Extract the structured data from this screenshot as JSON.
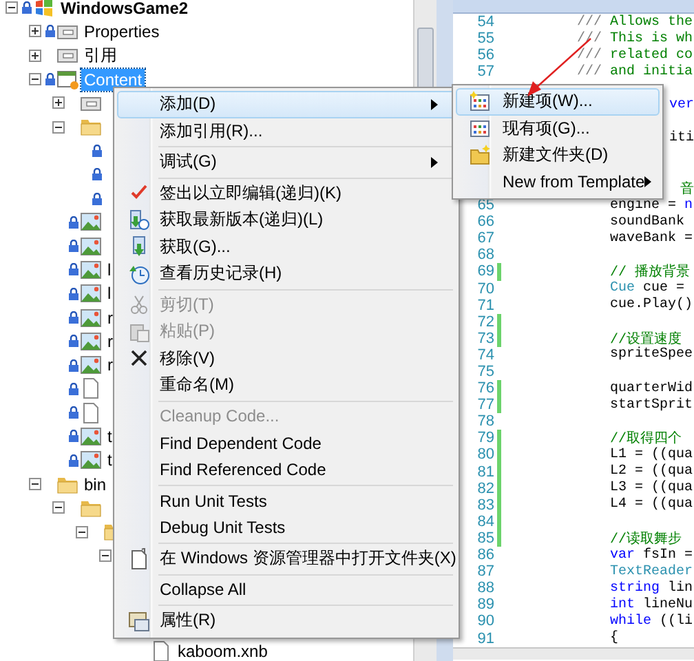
{
  "solution_explorer": {
    "tree": [
      {
        "label": "WindowsGame2",
        "kind": "project",
        "locked": true,
        "expanded": true,
        "selected": false,
        "children": [
          {
            "label": "Properties",
            "kind": "properties",
            "locked": true,
            "expanded": false,
            "selected": false
          },
          {
            "label": "引用",
            "kind": "references",
            "expanded": false,
            "selected": false
          },
          {
            "label": "Content",
            "kind": "content",
            "locked": true,
            "expanded": true,
            "selected": true,
            "children": [
              {
                "kind": "references",
                "expanded": false,
                "selected": false
              },
              {
                "kind": "folder",
                "expanded": true,
                "selected": false,
                "children": [
                  {
                    "locked": true,
                    "selected": false
                  },
                  {
                    "locked": true,
                    "selected": false
                  },
                  {
                    "locked": true,
                    "selected": false
                  }
                ]
              },
              {
                "kind": "image",
                "locked": true,
                "selected": false
              },
              {
                "kind": "image",
                "locked": true,
                "selected": false
              },
              {
                "label": "l",
                "kind": "image",
                "locked": true,
                "selected": false
              },
              {
                "label": "l",
                "kind": "image",
                "locked": true,
                "selected": false
              },
              {
                "label": "r",
                "kind": "image",
                "locked": true,
                "selected": false
              },
              {
                "label": "r",
                "kind": "image",
                "locked": true,
                "selected": false
              },
              {
                "label": "r",
                "kind": "image",
                "locked": true,
                "selected": false
              },
              {
                "kind": "file",
                "locked": true,
                "selected": false
              },
              {
                "kind": "file",
                "locked": true,
                "selected": false
              },
              {
                "label": "t",
                "kind": "image",
                "locked": true,
                "selected": false
              },
              {
                "label": "t",
                "kind": "image",
                "locked": true,
                "selected": false
              }
            ]
          },
          {
            "label": "bin",
            "kind": "folder",
            "expanded": true,
            "selected": false,
            "children": [
              {
                "kind": "folder",
                "expanded": true,
                "selected": false,
                "children": [
                  {
                    "kind": "folder",
                    "expanded": true,
                    "selected": false,
                    "children": [
                      {
                        "expanded": true,
                        "selected": false,
                        "children": [
                          {
                            "label": "kaboom.xnb",
                            "kind": "file",
                            "selected": false
                          }
                        ]
                      }
                    ]
                  }
                ]
              }
            ]
          }
        ]
      }
    ]
  },
  "editor": {
    "lines": [
      {
        "number": "54",
        "kind": "doc",
        "changed": false,
        "tokens": [
          {
            "text": "///",
            "kind": "doc-mark"
          },
          {
            "text": " Allows the",
            "kind": "comment"
          }
        ]
      },
      {
        "number": "55",
        "kind": "doc",
        "changed": false,
        "tokens": [
          {
            "text": "///",
            "kind": "doc-mark"
          },
          {
            "text": " This is wh",
            "kind": "comment"
          }
        ]
      },
      {
        "number": "56",
        "kind": "doc",
        "changed": false,
        "tokens": [
          {
            "text": "///",
            "kind": "doc-mark"
          },
          {
            "text": " related co",
            "kind": "comment"
          }
        ]
      },
      {
        "number": "57",
        "kind": "doc",
        "changed": false,
        "tokens": [
          {
            "text": "///",
            "kind": "doc-mark"
          },
          {
            "text": " and initia",
            "kind": "comment"
          }
        ]
      },
      {
        "kind": "covered"
      },
      {
        "kind": "covered",
        "tokens": [
          {
            "text": "ver",
            "kind": "keyword"
          }
        ]
      },
      {
        "kind": "covered"
      },
      {
        "kind": "covered",
        "tokens": [
          {
            "text": "iti",
            "kind": "plain"
          }
        ]
      },
      {
        "kind": "covered"
      },
      {
        "kind": "covered"
      },
      {
        "kind": "covered",
        "tokens": [
          {
            "text": "音",
            "kind": "comment"
          }
        ]
      },
      {
        "number": "65",
        "kind": "code",
        "changed": false,
        "tokens": [
          {
            "text": "engine = ",
            "kind": "plain"
          },
          {
            "text": "n",
            "kind": "keyword"
          }
        ]
      },
      {
        "number": "66",
        "kind": "code",
        "changed": false,
        "tokens": [
          {
            "text": "soundBank",
            "kind": "plain"
          }
        ]
      },
      {
        "number": "67",
        "kind": "code",
        "changed": false,
        "tokens": [
          {
            "text": "waveBank =",
            "kind": "plain"
          }
        ]
      },
      {
        "number": "68",
        "kind": "code",
        "changed": false
      },
      {
        "number": "69",
        "kind": "code",
        "changed": true,
        "tokens": [
          {
            "text": "// 播放背景",
            "kind": "comment"
          }
        ]
      },
      {
        "number": "70",
        "kind": "code",
        "changed": false,
        "tokens": [
          {
            "text": "Cue",
            "kind": "type"
          },
          {
            "text": " cue =",
            "kind": "plain"
          }
        ]
      },
      {
        "number": "71",
        "kind": "code",
        "changed": false,
        "tokens": [
          {
            "text": "cue.Play()",
            "kind": "plain"
          }
        ]
      },
      {
        "number": "72",
        "kind": "code",
        "changed": true
      },
      {
        "number": "73",
        "kind": "code",
        "changed": true,
        "tokens": [
          {
            "text": "//设置速度",
            "kind": "comment"
          }
        ]
      },
      {
        "number": "74",
        "kind": "code",
        "changed": false,
        "tokens": [
          {
            "text": "spriteSpee",
            "kind": "plain"
          }
        ]
      },
      {
        "number": "75",
        "kind": "code",
        "changed": false
      },
      {
        "number": "76",
        "kind": "code",
        "changed": true,
        "tokens": [
          {
            "text": "quarterWid",
            "kind": "plain"
          }
        ]
      },
      {
        "number": "77",
        "kind": "code",
        "changed": true,
        "tokens": [
          {
            "text": "startSprit",
            "kind": "plain"
          }
        ]
      },
      {
        "number": "78",
        "kind": "code",
        "changed": false
      },
      {
        "number": "79",
        "kind": "code",
        "changed": true,
        "tokens": [
          {
            "text": "//取得四个",
            "kind": "comment"
          }
        ]
      },
      {
        "number": "80",
        "kind": "code",
        "changed": true,
        "tokens": [
          {
            "text": "L1 = ((qua",
            "kind": "plain"
          }
        ]
      },
      {
        "number": "81",
        "kind": "code",
        "changed": true,
        "tokens": [
          {
            "text": "L2 = ((qua",
            "kind": "plain"
          }
        ]
      },
      {
        "number": "82",
        "kind": "code",
        "changed": true,
        "tokens": [
          {
            "text": "L3 = ((qua",
            "kind": "plain"
          }
        ]
      },
      {
        "number": "83",
        "kind": "code",
        "changed": true,
        "tokens": [
          {
            "text": "L4 = ((qua",
            "kind": "plain"
          }
        ]
      },
      {
        "number": "84",
        "kind": "code",
        "changed": true
      },
      {
        "number": "85",
        "kind": "code",
        "changed": true,
        "tokens": [
          {
            "text": "//读取舞步",
            "kind": "comment"
          }
        ]
      },
      {
        "number": "86",
        "kind": "code",
        "changed": false,
        "tokens": [
          {
            "text": "var",
            "kind": "keyword"
          },
          {
            "text": " fsIn =",
            "kind": "plain"
          }
        ]
      },
      {
        "number": "87",
        "kind": "code",
        "changed": false,
        "tokens": [
          {
            "text": "TextReader",
            "kind": "type"
          }
        ]
      },
      {
        "number": "88",
        "kind": "code",
        "changed": false,
        "tokens": [
          {
            "text": "string",
            "kind": "keyword"
          },
          {
            "text": " lin",
            "kind": "plain"
          }
        ]
      },
      {
        "number": "89",
        "kind": "code",
        "changed": false,
        "tokens": [
          {
            "text": "int",
            "kind": "keyword"
          },
          {
            "text": " lineNu",
            "kind": "plain"
          }
        ]
      },
      {
        "number": "90",
        "kind": "code",
        "changed": false,
        "tokens": [
          {
            "text": "while",
            "kind": "keyword"
          },
          {
            "text": " ((li",
            "kind": "plain"
          }
        ]
      },
      {
        "number": "91",
        "kind": "code",
        "changed": false,
        "tokens": [
          {
            "text": "{",
            "kind": "plain"
          }
        ]
      }
    ]
  },
  "context_menu": {
    "items": [
      {
        "kind": "item",
        "label": "添加(D)",
        "selected": true,
        "disabled": false,
        "submenu": true
      },
      {
        "kind": "item",
        "label": "添加引用(R)...",
        "selected": false,
        "disabled": false,
        "submenu": false
      },
      {
        "kind": "separator"
      },
      {
        "kind": "item",
        "label": "调试(G)",
        "selected": false,
        "disabled": false,
        "submenu": true
      },
      {
        "kind": "separator"
      },
      {
        "kind": "item",
        "label": "签出以立即编辑(递归)(K)",
        "selected": false,
        "disabled": false,
        "submenu": false
      },
      {
        "kind": "item",
        "label": "获取最新版本(递归)(L)",
        "selected": false,
        "disabled": false,
        "submenu": false
      },
      {
        "kind": "item",
        "label": "获取(G)...",
        "selected": false,
        "disabled": false,
        "submenu": false
      },
      {
        "kind": "item",
        "label": "查看历史记录(H)",
        "selected": false,
        "disabled": false,
        "submenu": false
      },
      {
        "kind": "separator"
      },
      {
        "kind": "item",
        "label": "剪切(T)",
        "selected": false,
        "disabled": true,
        "submenu": false
      },
      {
        "kind": "item",
        "label": "粘贴(P)",
        "selected": false,
        "disabled": true,
        "submenu": false
      },
      {
        "kind": "item",
        "label": "移除(V)",
        "selected": false,
        "disabled": false,
        "submenu": false
      },
      {
        "kind": "item",
        "label": "重命名(M)",
        "selected": false,
        "disabled": false,
        "submenu": false
      },
      {
        "kind": "separator"
      },
      {
        "kind": "item",
        "label": "Cleanup Code...",
        "selected": false,
        "disabled": true,
        "submenu": false
      },
      {
        "kind": "item",
        "label": "Find Dependent Code",
        "selected": false,
        "disabled": false,
        "submenu": false
      },
      {
        "kind": "item",
        "label": "Find Referenced Code",
        "selected": false,
        "disabled": false,
        "submenu": false
      },
      {
        "kind": "separator"
      },
      {
        "kind": "item",
        "label": "Run Unit Tests",
        "selected": false,
        "disabled": false,
        "submenu": false
      },
      {
        "kind": "item",
        "label": "Debug Unit Tests",
        "selected": false,
        "disabled": false,
        "submenu": false
      },
      {
        "kind": "separator"
      },
      {
        "kind": "item",
        "label": "在 Windows 资源管理器中打开文件夹(X)",
        "selected": false,
        "disabled": false,
        "submenu": false
      },
      {
        "kind": "separator"
      },
      {
        "kind": "item",
        "label": "Collapse All",
        "selected": false,
        "disabled": false,
        "submenu": false
      },
      {
        "kind": "separator"
      },
      {
        "kind": "item",
        "label": "属性(R)",
        "selected": false,
        "disabled": false,
        "submenu": false
      }
    ]
  },
  "submenu": {
    "items": [
      {
        "label": "新建项(W)...",
        "selected": true,
        "submenu": false
      },
      {
        "label": "现有项(G)...",
        "selected": false,
        "submenu": false
      },
      {
        "label": "新建文件夹(D)",
        "selected": false,
        "submenu": false
      },
      {
        "label": "New from Template",
        "selected": false,
        "submenu": true
      }
    ]
  }
}
